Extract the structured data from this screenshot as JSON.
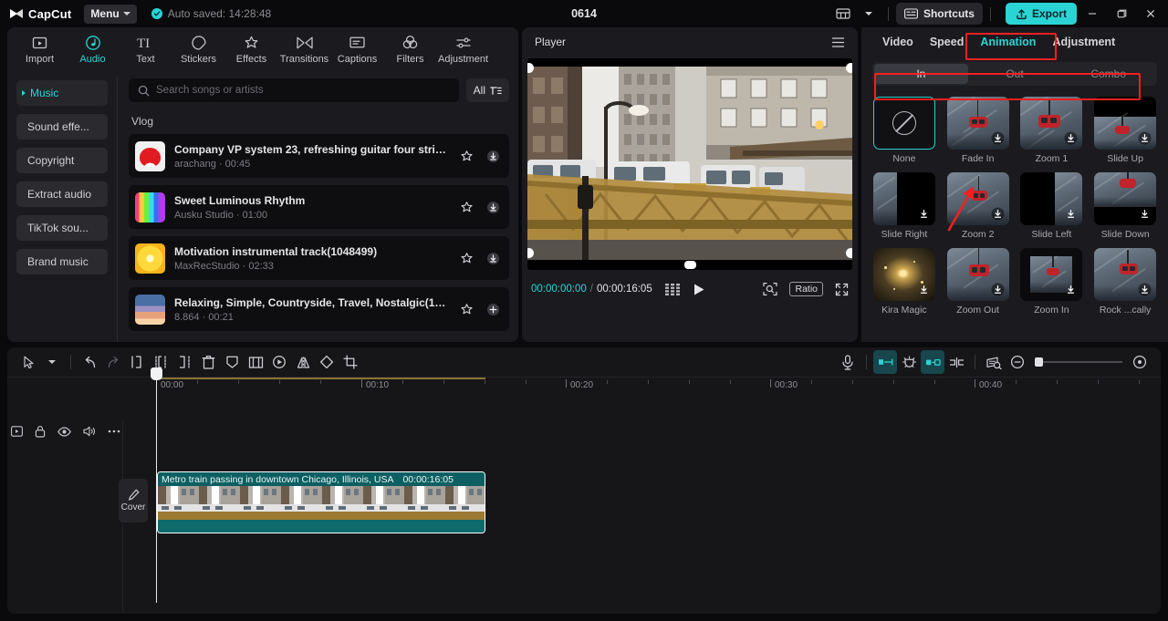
{
  "titlebar": {
    "brand": "CapCut",
    "menu_label": "Menu",
    "autosave_text": "Auto saved: 14:28:48",
    "project_title": "0614",
    "shortcuts_label": "Shortcuts",
    "export_label": "Export",
    "accent_color": "#2ad4d4"
  },
  "nav_tabs": [
    {
      "label": "Import",
      "icon": "import-icon",
      "active": false
    },
    {
      "label": "Audio",
      "icon": "audio-note-icon",
      "active": true
    },
    {
      "label": "Text",
      "icon": "text-icon",
      "active": false
    },
    {
      "label": "Stickers",
      "icon": "sticker-icon",
      "active": false
    },
    {
      "label": "Effects",
      "icon": "effects-star-icon",
      "active": false
    },
    {
      "label": "Transitions",
      "icon": "transitions-icon",
      "active": false
    },
    {
      "label": "Captions",
      "icon": "captions-icon",
      "active": false
    },
    {
      "label": "Filters",
      "icon": "filters-icon",
      "active": false
    },
    {
      "label": "Adjustment",
      "icon": "adjustment-sliders-icon",
      "active": false
    }
  ],
  "categories": [
    {
      "label": "Music",
      "active": true
    },
    {
      "label": "Sound effe...",
      "active": false
    },
    {
      "label": "Copyright",
      "active": false
    },
    {
      "label": "Extract audio",
      "active": false
    },
    {
      "label": "TikTok sou...",
      "active": false
    },
    {
      "label": "Brand music",
      "active": false
    }
  ],
  "search": {
    "placeholder": "Search songs or artists",
    "value": "",
    "filter_label": "All"
  },
  "music": {
    "group_label": "Vlog",
    "tracks": [
      {
        "title": "Company VP system 23, refreshing guitar four strike...",
        "artist": "arachang",
        "duration": "00:45",
        "action": "download"
      },
      {
        "title": "Sweet Luminous Rhythm",
        "artist": "Ausku Studio",
        "duration": "01:00",
        "action": "download"
      },
      {
        "title": "Motivation instrumental track(1048499)",
        "artist": "MaxRecStudio",
        "duration": "02:33",
        "action": "download"
      },
      {
        "title": "Relaxing, Simple, Countryside, Travel, Nostalgic(1307...",
        "artist": "8.864",
        "duration": "00:21",
        "action": "add"
      }
    ]
  },
  "player": {
    "title": "Player",
    "current_time": "00:00:00:00",
    "total_time": "00:00:16:05",
    "ratio_label": "Ratio"
  },
  "properties": {
    "tabs": [
      {
        "label": "Video",
        "active": false
      },
      {
        "label": "Speed",
        "active": false
      },
      {
        "label": "Animation",
        "active": true
      },
      {
        "label": "Adjustment",
        "active": false
      }
    ],
    "segments": [
      {
        "label": "In",
        "active": true
      },
      {
        "label": "Out",
        "active": false
      },
      {
        "label": "Combo",
        "active": false
      }
    ],
    "animations": [
      {
        "label": "None",
        "kind": "none",
        "selected": true,
        "downloadable": false
      },
      {
        "label": "Fade In",
        "kind": "gondola",
        "selected": false,
        "downloadable": true
      },
      {
        "label": "Zoom 1",
        "kind": "gondola",
        "selected": false,
        "downloadable": true
      },
      {
        "label": "Slide Up",
        "kind": "slide-up",
        "selected": false,
        "downloadable": true
      },
      {
        "label": "Slide Right",
        "kind": "slide-right",
        "selected": false,
        "downloadable": true
      },
      {
        "label": "Zoom 2",
        "kind": "gondola",
        "selected": false,
        "downloadable": true
      },
      {
        "label": "Slide Left",
        "kind": "slide-left",
        "selected": false,
        "downloadable": true
      },
      {
        "label": "Slide Down",
        "kind": "slide-down",
        "selected": false,
        "downloadable": true
      },
      {
        "label": "Kira Magic",
        "kind": "sparkle",
        "selected": false,
        "downloadable": true
      },
      {
        "label": "Zoom Out",
        "kind": "gondola",
        "selected": false,
        "downloadable": true
      },
      {
        "label": "Zoom In",
        "kind": "zoom-in",
        "selected": false,
        "downloadable": true
      },
      {
        "label": "Rock ...cally",
        "kind": "gondola",
        "selected": false,
        "downloadable": true
      }
    ]
  },
  "timeline": {
    "ruler_labels": [
      "00:00",
      "00:10",
      "00:20",
      "00:30",
      "00:40"
    ],
    "cover_label": "Cover",
    "clip": {
      "title": "Metro train passing in downtown Chicago, Illinois, USA",
      "duration": "00:00:16:05"
    }
  },
  "annotations": {
    "highlight_color": "#f42020",
    "boxes": [
      "animation-tab",
      "in-out-combo-segment"
    ],
    "arrow_target": "Fade In"
  }
}
